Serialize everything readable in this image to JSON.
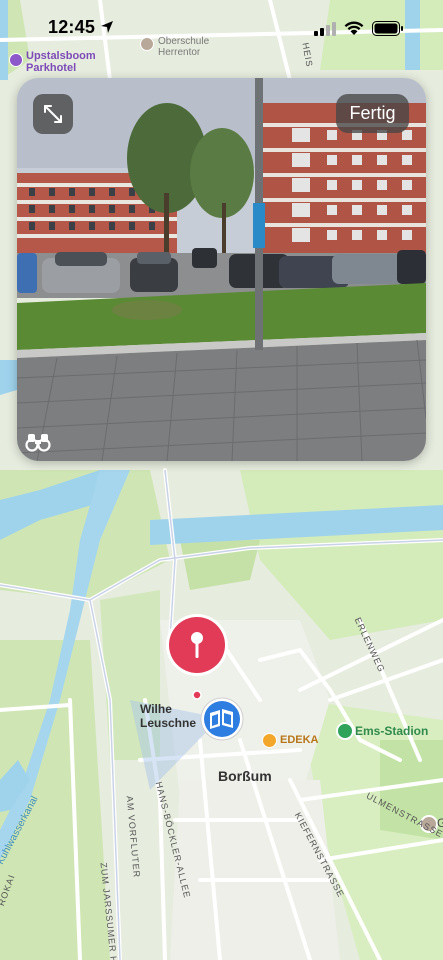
{
  "status_bar": {
    "time": "12:45"
  },
  "look_around": {
    "done_label": "Fertig"
  },
  "map_labels": {
    "hotel": "Upstalsboom\nParkhotel",
    "school": "Oberschule\nHerrentor",
    "place": "Wilhe       \nLeuschne          e",
    "district": "Borßum",
    "edeka": "EDEKA",
    "stadium": "Ems-Stadion",
    "street_erlen": "ERLENWEG",
    "street_ulmen": "ULMENSTRASSE",
    "street_hans": "HANS-BÖCKLER-ALLEE",
    "street_kiefern": "KIEFERNSTRASSE",
    "street_vorfluter": "AM VORFLUTER",
    "street_jarssum": "ZUM JARSSUMER H",
    "canal": "Kuhlwasserkanal",
    "street_rokai": "ROKAI",
    "street_heis": "HEIS",
    "street_g": "G"
  }
}
